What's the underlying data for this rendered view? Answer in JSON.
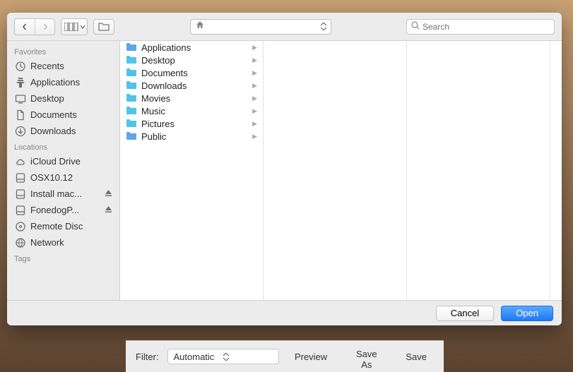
{
  "toolbar": {
    "search_placeholder": "Search"
  },
  "sidebar": {
    "sections": [
      {
        "title": "Favorites",
        "items": [
          {
            "label": "Recents",
            "icon": "clock"
          },
          {
            "label": "Applications",
            "icon": "apps"
          },
          {
            "label": "Desktop",
            "icon": "desktop"
          },
          {
            "label": "Documents",
            "icon": "documents"
          },
          {
            "label": "Downloads",
            "icon": "downloads"
          }
        ]
      },
      {
        "title": "Locations",
        "items": [
          {
            "label": "iCloud Drive",
            "icon": "cloud"
          },
          {
            "label": "OSX10.12",
            "icon": "disk"
          },
          {
            "label": "Install mac...",
            "icon": "disk",
            "eject": true
          },
          {
            "label": "FonedogP...",
            "icon": "disk",
            "eject": true
          },
          {
            "label": "Remote Disc",
            "icon": "disc"
          },
          {
            "label": "Network",
            "icon": "network"
          }
        ]
      },
      {
        "title": "Tags",
        "items": []
      }
    ]
  },
  "columns": [
    {
      "items": [
        {
          "label": "Applications",
          "kind": "folder-blue"
        },
        {
          "label": "Desktop",
          "kind": "folder-cyan"
        },
        {
          "label": "Documents",
          "kind": "folder-cyan"
        },
        {
          "label": "Downloads",
          "kind": "folder-cyan"
        },
        {
          "label": "Movies",
          "kind": "folder-cyan"
        },
        {
          "label": "Music",
          "kind": "folder-cyan"
        },
        {
          "label": "Pictures",
          "kind": "folder-cyan"
        },
        {
          "label": "Public",
          "kind": "folder-blue"
        }
      ]
    },
    {
      "items": []
    },
    {
      "items": []
    }
  ],
  "footer": {
    "cancel": "Cancel",
    "open": "Open"
  },
  "bottom": {
    "filter_label": "Filter:",
    "filter_value": "Automatic",
    "preview": "Preview",
    "save_as": "Save As",
    "save": "Save"
  }
}
